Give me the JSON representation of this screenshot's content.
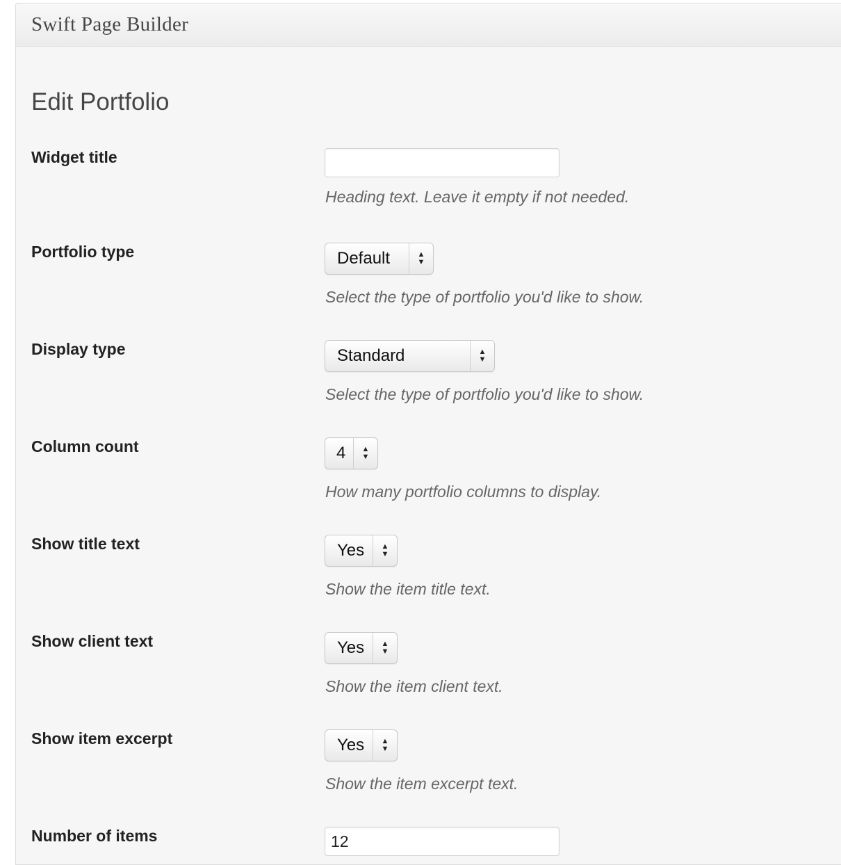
{
  "panel": {
    "title": "Swift Page Builder"
  },
  "page": {
    "title": "Edit Portfolio"
  },
  "fields": {
    "widget_title": {
      "label": "Widget title",
      "value": "",
      "description": "Heading text. Leave it empty if not needed."
    },
    "portfolio_type": {
      "label": "Portfolio type",
      "value": "Default",
      "description": "Select the type of portfolio you'd like to show."
    },
    "display_type": {
      "label": "Display type",
      "value": "Standard",
      "description": "Select the type of portfolio you'd like to show."
    },
    "column_count": {
      "label": "Column count",
      "value": "4",
      "description": "How many portfolio columns to display."
    },
    "show_title_text": {
      "label": "Show title text",
      "value": "Yes",
      "description": "Show the item title text."
    },
    "show_client_text": {
      "label": "Show client text",
      "value": "Yes",
      "description": "Show the item client text."
    },
    "show_item_excerpt": {
      "label": "Show item excerpt",
      "value": "Yes",
      "description": "Show the item excerpt text."
    },
    "number_of_items": {
      "label": "Number of items",
      "value": "12"
    }
  },
  "icons": {
    "select_arrow_up": "▲",
    "select_arrow_down": "▼"
  }
}
